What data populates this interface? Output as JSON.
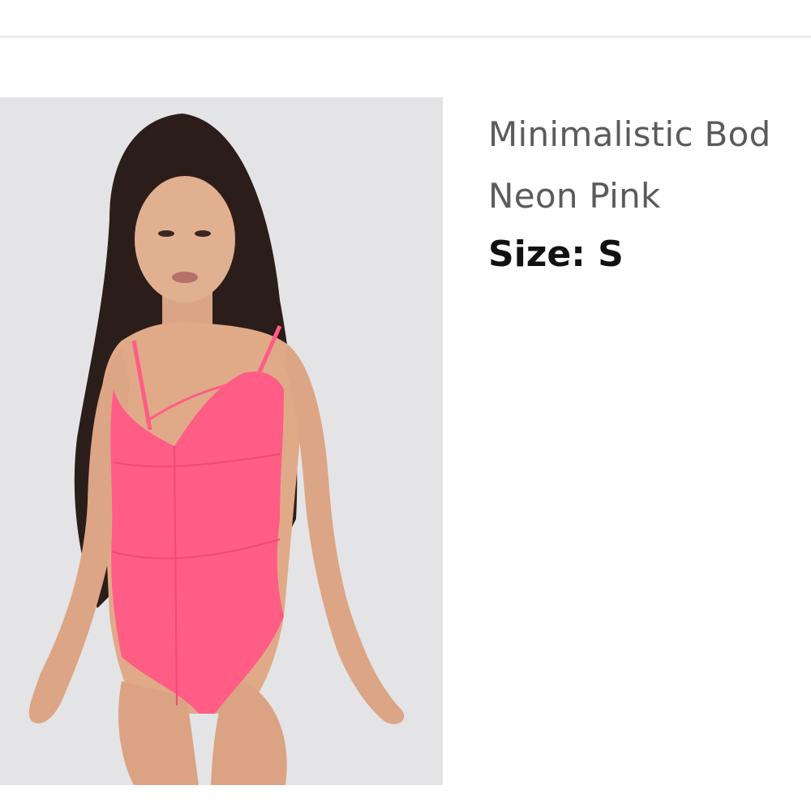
{
  "product": {
    "name_line1": "Minimalistic Bod",
    "name_line2": "Neon Pink",
    "size_label": "Size:",
    "size_value": "S",
    "image_alt": "Model wearing the neon pink bodysuit"
  },
  "colors": {
    "image_background": "#e4e4e6",
    "garment": "#ff5c86",
    "title_text": "#5b5b5b",
    "size_text": "#111111"
  }
}
